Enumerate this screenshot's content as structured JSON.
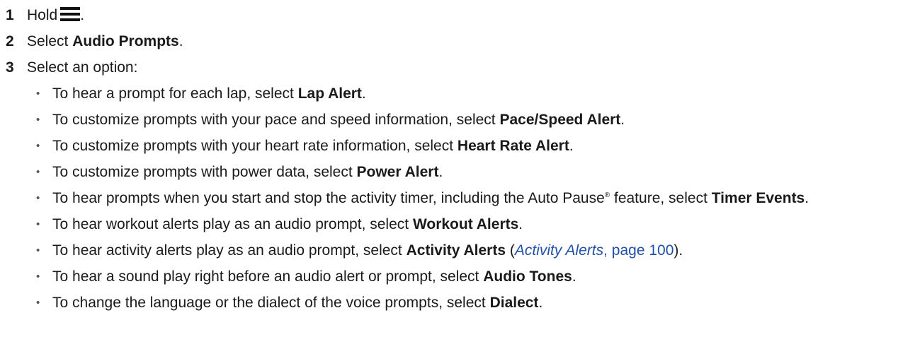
{
  "steps": [
    {
      "num": "1",
      "text": "Hold",
      "after_icon": "."
    },
    {
      "num": "2",
      "pre": "Select ",
      "bold": "Audio Prompts",
      "post": "."
    },
    {
      "num": "3",
      "text": "Select an option:"
    }
  ],
  "menu_icon": "menu-icon",
  "options": [
    {
      "pre": "To hear a prompt for each lap, select ",
      "bold": "Lap Alert",
      "post": "."
    },
    {
      "pre": "To customize prompts with your pace and speed information, select ",
      "bold": "Pace/Speed Alert",
      "post": "."
    },
    {
      "pre": "To customize prompts with your heart rate information, select ",
      "bold": "Heart Rate Alert",
      "post": "."
    },
    {
      "pre": "To customize prompts with power data, select ",
      "bold": "Power Alert",
      "post": "."
    },
    {
      "pre": "To hear prompts when you start and stop the activity timer, including the Auto Pause",
      "reg": "®",
      "pre2": " feature, select ",
      "bold": "Timer Events",
      "post": "."
    },
    {
      "pre": "To hear workout alerts play as an audio prompt, select ",
      "bold": "Workout Alerts",
      "post": "."
    },
    {
      "pre": "To hear activity alerts play as an audio prompt, select ",
      "bold": "Activity Alerts",
      "mid": " (",
      "link_italic": "Activity Alerts",
      "link_sep": ", ",
      "link_page": "page 100",
      "post": ")."
    },
    {
      "pre": "To hear a sound play right before an audio alert or prompt, select ",
      "bold": "Audio Tones",
      "post": "."
    },
    {
      "pre": "To change the language or the dialect of the voice prompts, select ",
      "bold": "Dialect",
      "post": "."
    }
  ]
}
